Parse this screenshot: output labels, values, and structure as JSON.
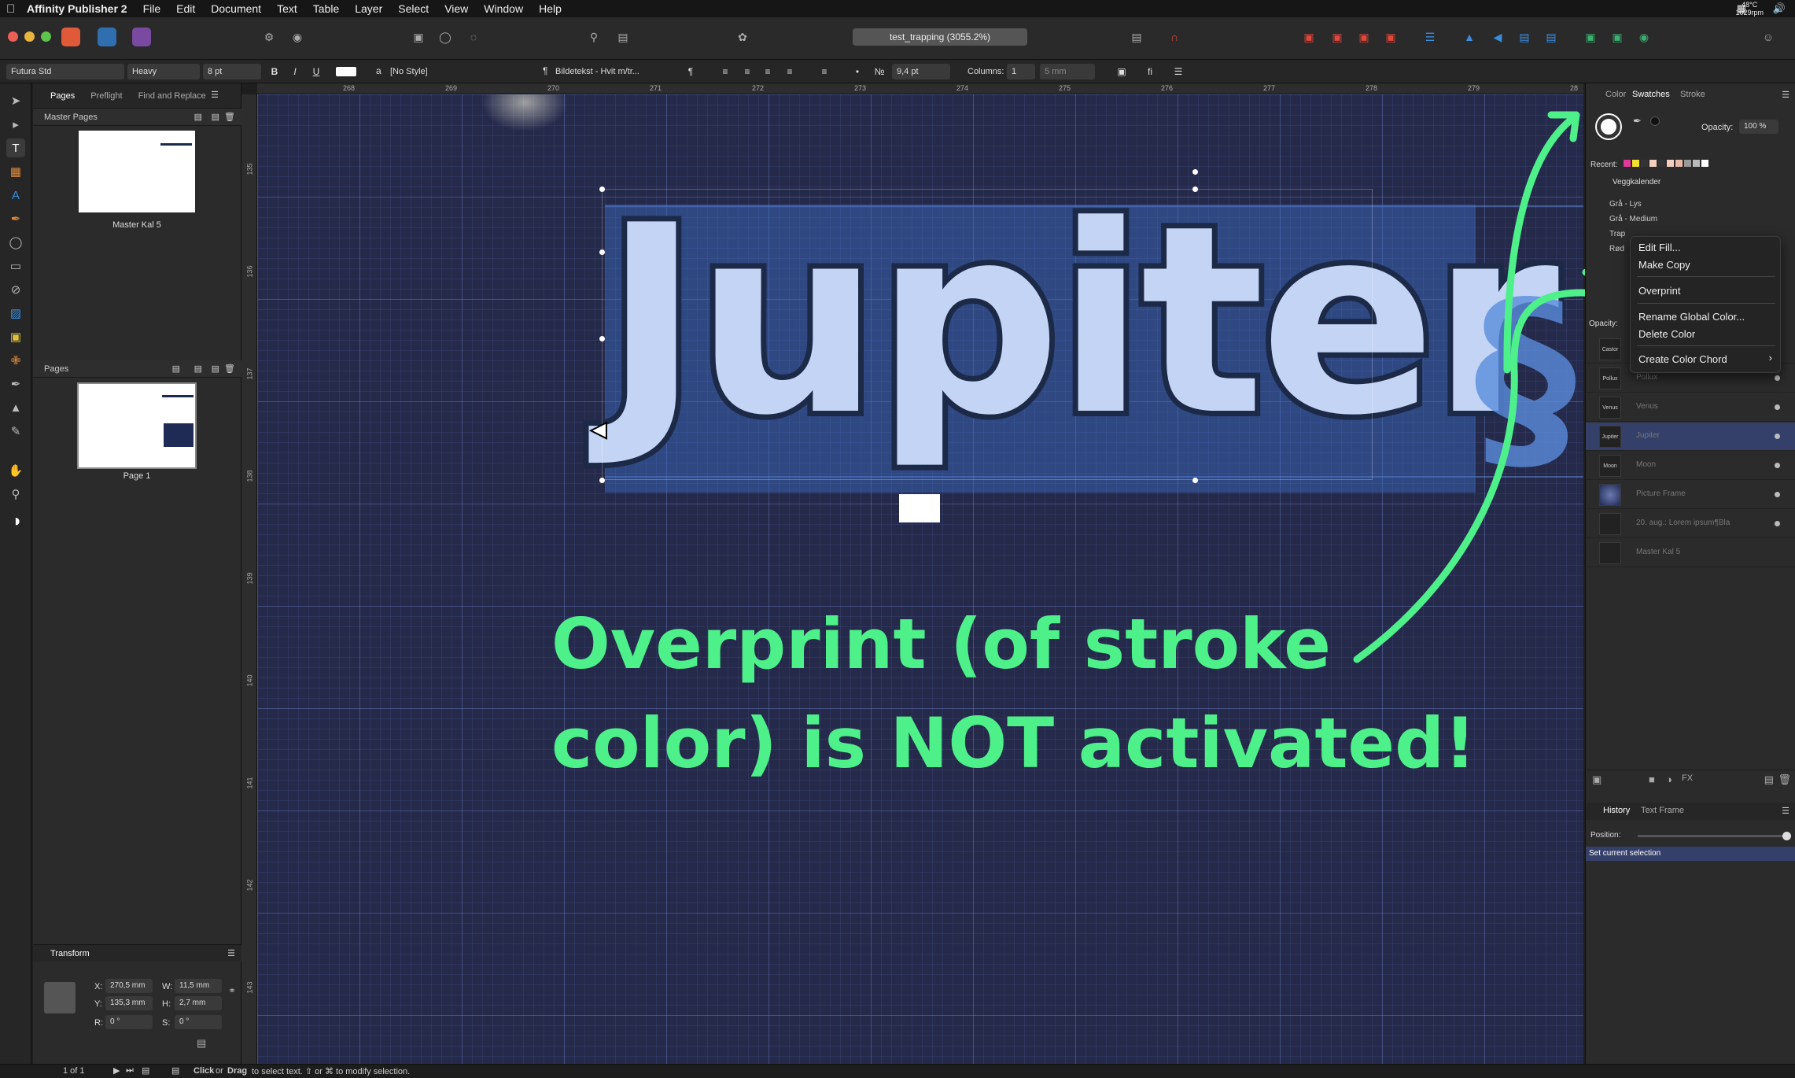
{
  "menubar": {
    "app_name": "Affinity Publisher 2",
    "items": [
      "File",
      "Edit",
      "Document",
      "Text",
      "Table",
      "Layer",
      "Select",
      "View",
      "Window",
      "Help"
    ],
    "temp": "48°C",
    "rpm": "1029rpm"
  },
  "toolbar": {
    "document_title": "test_trapping (3055.2%)"
  },
  "context_bar": {
    "font_family": "Futura Std",
    "font_weight": "Heavy",
    "font_size": "8 pt",
    "bold": "B",
    "italic": "I",
    "underline": "U",
    "char_style": "[No Style]",
    "para_style": "Bildetekst - Hvit m/tr...",
    "leading": "9,4 pt",
    "columns_label": "Columns:",
    "columns_value": "1",
    "gutter": "5 mm"
  },
  "left_panel": {
    "tabs": [
      "Pages",
      "Preflight",
      "Find and Replace"
    ],
    "master_pages_header": "Master Pages",
    "master_page_name": "Master Kal 5",
    "pages_header": "Pages",
    "page_name": "Page 1",
    "transform_header": "Transform",
    "transform": {
      "x_label": "X:",
      "x": "270,5 mm",
      "y_label": "Y:",
      "y": "135,3 mm",
      "w_label": "W:",
      "w": "11,5 mm",
      "h_label": "H:",
      "h": "2,7 mm",
      "r_label": "R:",
      "r": "0 °",
      "s_label": "S:",
      "s": "0 °"
    }
  },
  "rulers": {
    "h_ticks": [
      "268",
      "269",
      "270",
      "271",
      "272",
      "273",
      "274",
      "275",
      "276",
      "277",
      "278",
      "279",
      "28"
    ],
    "v_ticks": [
      "135",
      "136",
      "137",
      "138",
      "139",
      "140",
      "141",
      "142",
      "143"
    ]
  },
  "canvas": {
    "headline": "Jupiter",
    "glyph": "§",
    "annotation_line1": "Overprint (of stroke",
    "annotation_line2": "color) is NOT activated!"
  },
  "right_panel": {
    "tabs": [
      "Color",
      "Swatches",
      "Stroke"
    ],
    "opacity_label": "Opacity:",
    "opacity_value": "100 %",
    "recent_label": "Recent:",
    "palette_name": "Veggkalender",
    "swatches": [
      "Grå - Lys",
      "Grå - Medium",
      "Trap",
      "Rød"
    ],
    "opacity2_label": "Opacity:",
    "layers": [
      {
        "thumb": "Castor",
        "name": ""
      },
      {
        "thumb": "Pollux",
        "name": "Pollux"
      },
      {
        "thumb": "Venus",
        "name": "Venus"
      },
      {
        "thumb": "Jupiter",
        "name": "Jupiter"
      },
      {
        "thumb": "Moon",
        "name": "Moon"
      },
      {
        "thumb": "",
        "name": "Picture Frame"
      },
      {
        "thumb": "",
        "name": "20. aug.: Lorem ipsum¶Bla"
      },
      {
        "thumb": "",
        "name": "Master Kal 5"
      }
    ],
    "history_tabs": [
      "History",
      "Text Frame"
    ],
    "position_label": "Position:",
    "history_entry": "Set current selection"
  },
  "context_menu": {
    "items": [
      "Edit Fill...",
      "Make Copy",
      "Overprint",
      "Rename Global Color...",
      "Delete Color",
      "Create Color Chord"
    ]
  },
  "statusbar": {
    "page_count": "1 of 1",
    "hint_click": "Click",
    "hint_or": "or",
    "hint_drag": "Drag",
    "hint_rest": "to select text. ⇧ or ⌘ to modify selection."
  },
  "colors": {
    "annotation_green": "#4ef08a",
    "canvas_bg": "#25294a",
    "selection": "#34406a",
    "accent_red": "#e0463a"
  }
}
